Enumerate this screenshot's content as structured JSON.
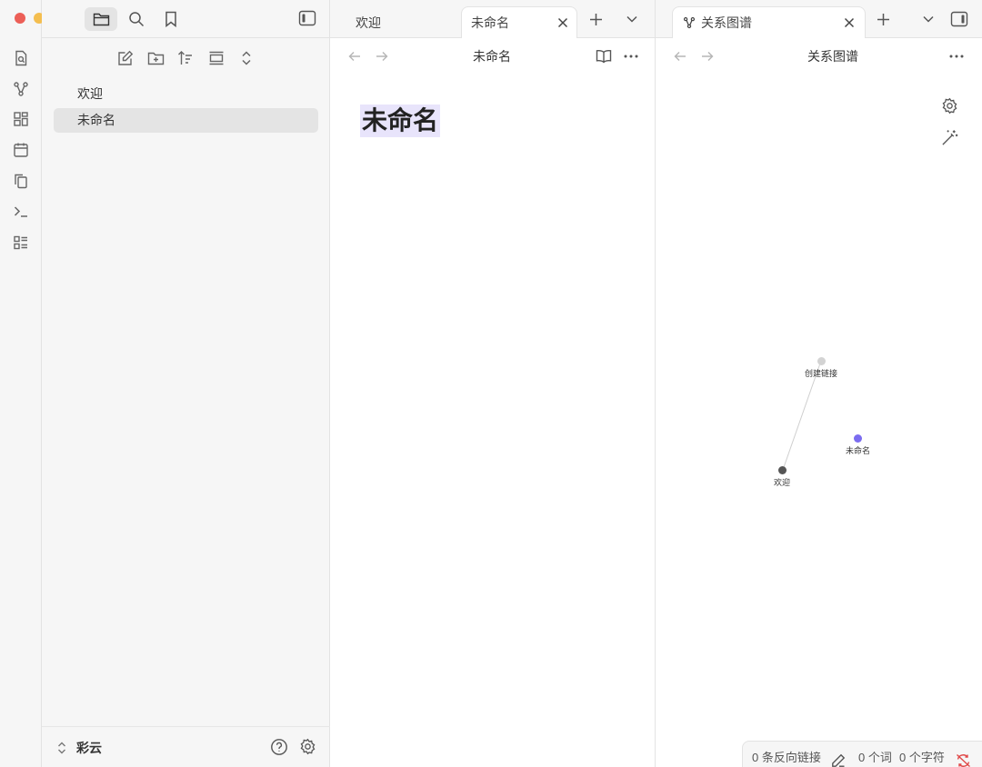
{
  "window": {
    "traffic_lights": {
      "close": "#ec5f57",
      "minimize": "#f4be4f",
      "zoom": "#61c454"
    }
  },
  "ribbon": {
    "icons": [
      "search-in-file-icon",
      "graph-view-icon",
      "canvas-icon",
      "daily-note-icon",
      "templates-icon",
      "command-palette-icon",
      "outline-icon"
    ]
  },
  "sidebar_tabs": [
    "folder-icon",
    "search-icon",
    "bookmark-icon"
  ],
  "explorer": {
    "toolbar": [
      "new-note-icon",
      "new-folder-icon",
      "sort-icon",
      "collapse-icon",
      "expand-collapse-icon"
    ],
    "files": [
      {
        "name": "欢迎",
        "selected": false
      },
      {
        "name": "未命名",
        "selected": true
      }
    ]
  },
  "vault": {
    "name": "彩云"
  },
  "editor": {
    "tabs": [
      {
        "label": "欢迎",
        "active": false
      },
      {
        "label": "未命名",
        "active": true
      }
    ],
    "view_title": "未命名",
    "document_heading": "未命名"
  },
  "graph": {
    "tab_label": "关系图谱",
    "view_title": "关系图谱",
    "nodes": [
      {
        "label": "创建链接",
        "color": "#d3d3d3"
      },
      {
        "label": "未命名",
        "color": "#7b6cf0"
      },
      {
        "label": "欢迎",
        "color": "#555555"
      }
    ],
    "edges": [
      [
        "欢迎",
        "创建链接"
      ]
    ]
  },
  "status_bar": {
    "backlinks": "0 条反向链接",
    "words": "0 个词",
    "chars": "0 个字符"
  }
}
